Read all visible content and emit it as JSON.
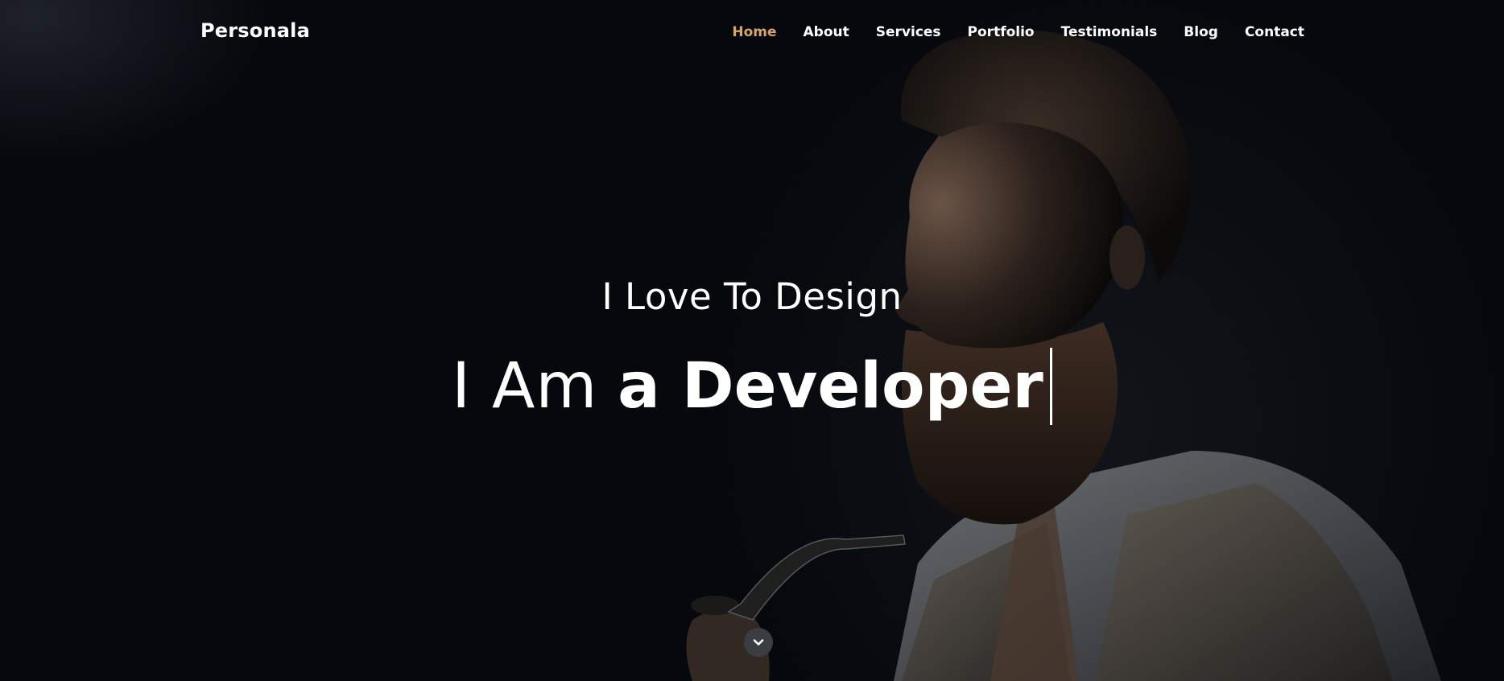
{
  "site": {
    "brand": "Personala"
  },
  "nav": {
    "items": [
      {
        "label": "Home",
        "active": true
      },
      {
        "label": "About",
        "active": false
      },
      {
        "label": "Services",
        "active": false
      },
      {
        "label": "Portfolio",
        "active": false
      },
      {
        "label": "Testimonials",
        "active": false
      },
      {
        "label": "Blog",
        "active": false
      },
      {
        "label": "Contact",
        "active": false
      }
    ]
  },
  "hero": {
    "subtitle": "I Love To Design",
    "title_prefix": "I Am",
    "title_typed": "a Developer",
    "scroll_icon": "chevron-down-icon"
  },
  "colors": {
    "background": "#05080d",
    "accent": "#d9a36c",
    "text": "#ffffff",
    "scroll_button": "#3a3d42"
  }
}
